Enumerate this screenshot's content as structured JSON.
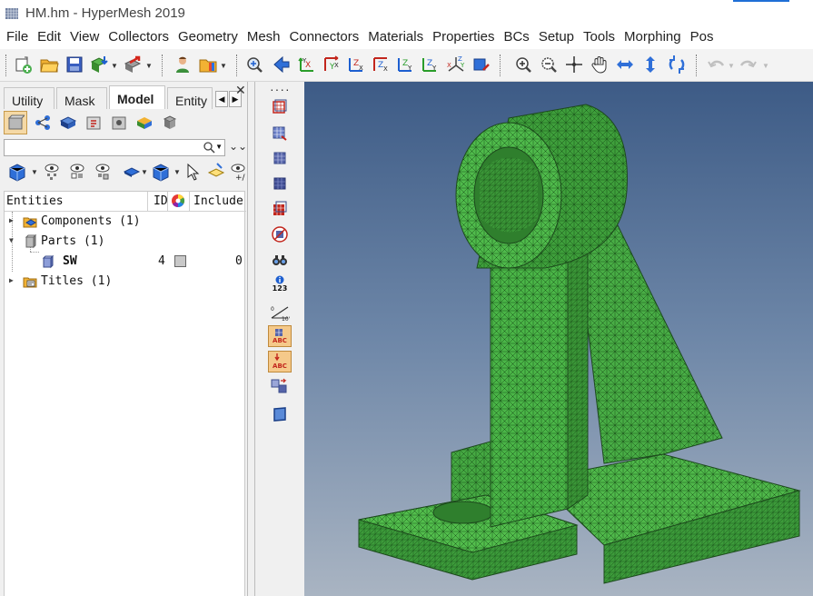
{
  "window": {
    "title": "HM.hm - HyperMesh 2019",
    "accent_color": "#1f6fd6"
  },
  "menu": {
    "items": [
      "File",
      "Edit",
      "View",
      "Collectors",
      "Geometry",
      "Mesh",
      "Connectors",
      "Materials",
      "Properties",
      "BCs",
      "Setup",
      "Tools",
      "Morphing",
      "Pos"
    ]
  },
  "toolbar": {
    "icons": [
      "new-model-icon",
      "open-folder-icon",
      "save-icon",
      "import-icon",
      "export-icon",
      "user-profile-icon",
      "reader-folder-icon",
      "zoom-window-icon",
      "previous-view-icon",
      "view-xy-top-icon",
      "view-xy-bottom-icon",
      "view-xz-top-icon",
      "view-xz-bottom-icon",
      "view-yz-left-icon",
      "view-yz-right-icon",
      "view-iso-icon",
      "view-reverse-icon",
      "zoom-in-icon",
      "zoom-out-icon",
      "center-icon",
      "pan-hand-icon",
      "translate-horizontal-icon",
      "translate-vertical-icon",
      "rotate-icon",
      "undo-icon",
      "redo-icon"
    ]
  },
  "browser": {
    "tabs": [
      {
        "label": "Utility",
        "active": false
      },
      {
        "label": "Mask",
        "active": false
      },
      {
        "label": "Model",
        "active": true
      },
      {
        "label": "Entity",
        "active": false
      }
    ],
    "entity_filters": [
      "component-view-icon",
      "assembly-view-icon",
      "material-view-icon",
      "property-view-icon",
      "solver-view-icon",
      "include-view-icon",
      "parts-view-icon"
    ],
    "search": {
      "value": "",
      "placeholder": ""
    },
    "columns": {
      "entities": "Entities",
      "id": "ID",
      "include": "Include"
    },
    "tree": [
      {
        "label": "Components",
        "count": "(1)",
        "expanded": false
      },
      {
        "label": "Parts",
        "count": "(1)",
        "expanded": true
      },
      {
        "label": "SW",
        "id": "4",
        "include": "0"
      },
      {
        "label": "Titles",
        "count": "(1)",
        "expanded": false
      }
    ]
  },
  "vertical_toolbar": {
    "icons": [
      "mesh-display-icon",
      "mesh-shaded-icon",
      "element-wireframe-icon",
      "element-shaded-icon",
      "element-color-icon",
      "visualization-options-icon",
      "find-icon",
      "numbers-icon",
      "measure-icon",
      "label-abc-icon",
      "label-abc-down-icon",
      "transparency-icon",
      "box-select-icon"
    ],
    "number_label": "123",
    "label_abc": "ABC"
  },
  "viewport": {
    "mesh_color": "#3faa3f",
    "background_top": "#3d5b86",
    "background_bottom": "#a9b4c2"
  }
}
